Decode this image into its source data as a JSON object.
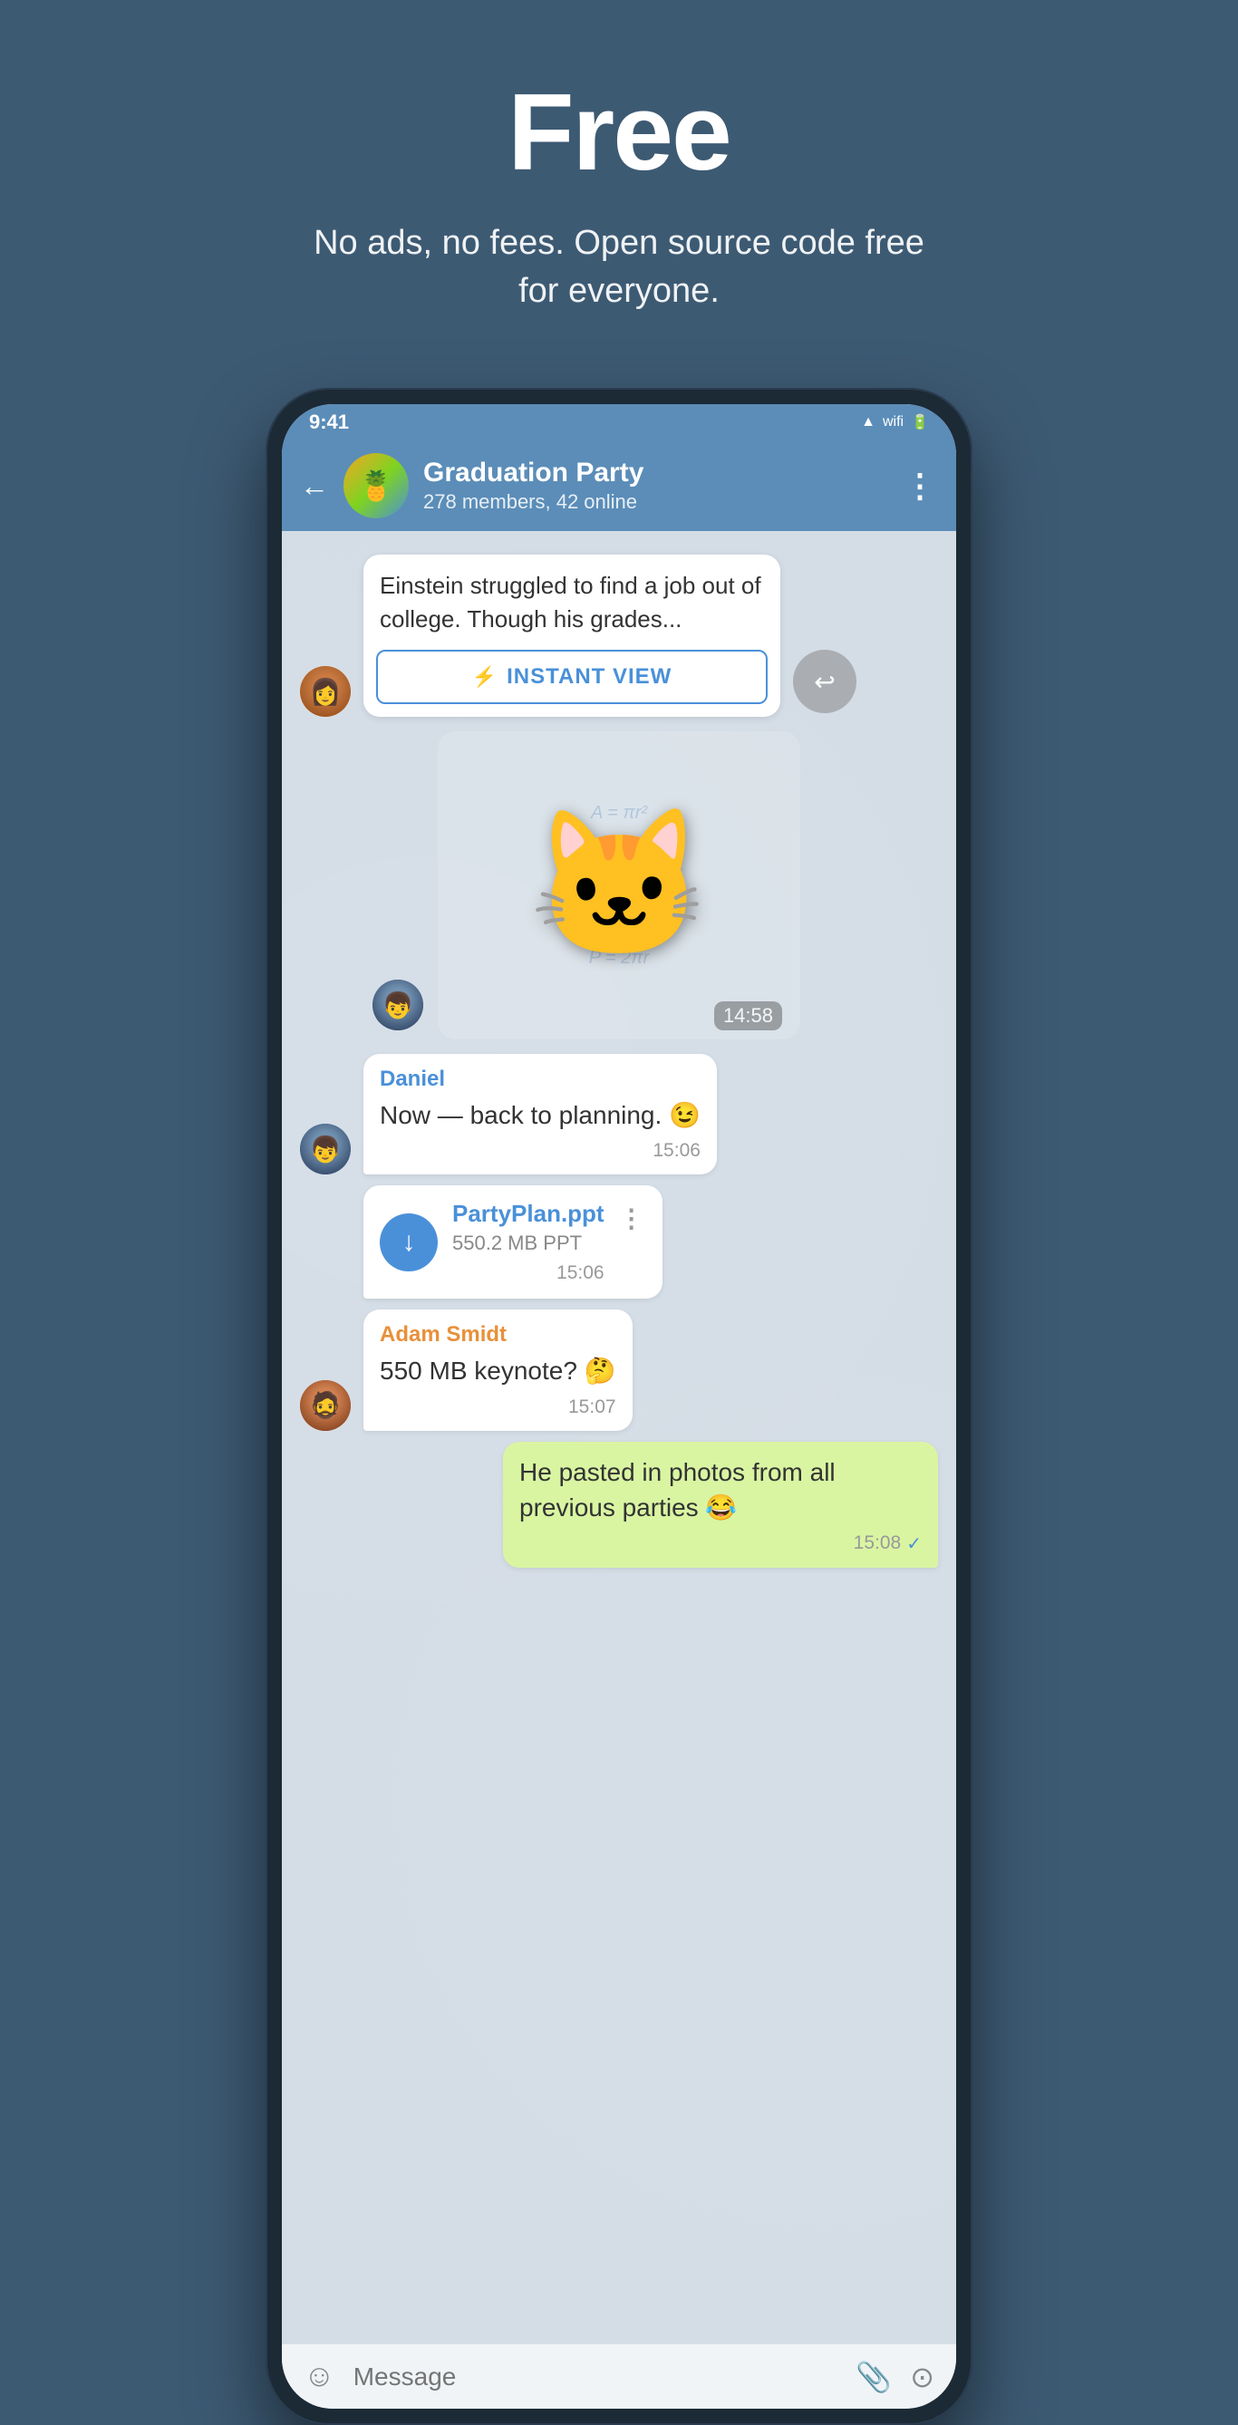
{
  "hero": {
    "title": "Free",
    "subtitle": "No ads, no fees. Open source code free for everyone."
  },
  "phone": {
    "statusBar": {
      "time": "9:41",
      "icons": "▲ WiFi 🔋"
    },
    "header": {
      "backLabel": "←",
      "groupName": "Graduation Party",
      "groupMeta": "278 members, 42 online",
      "moreLabel": "⋮"
    },
    "messages": [
      {
        "id": "article-msg",
        "type": "article",
        "text": "Einstein struggled to find a job out of college. Though his grades...",
        "buttonLabel": "INSTANT VIEW",
        "time": ""
      },
      {
        "id": "sticker-msg",
        "type": "sticker",
        "emoji": "🐱",
        "time": "14:58"
      },
      {
        "id": "daniel-msg",
        "type": "text",
        "sender": "Daniel",
        "senderColor": "blue",
        "text": "Now — back to planning. 😉",
        "time": "15:06"
      },
      {
        "id": "file-msg",
        "type": "file",
        "fileName": "PartyPlan.ppt",
        "fileSize": "550.2 MB PPT",
        "time": "15:06"
      },
      {
        "id": "adam-msg",
        "type": "text",
        "sender": "Adam Smidt",
        "senderColor": "orange",
        "text": "550 MB keynote? 🤔",
        "time": "15:07"
      },
      {
        "id": "self-msg",
        "type": "self",
        "text": "He pasted in photos from all previous parties 😂",
        "time": "15:08",
        "check": "✓"
      }
    ],
    "inputBar": {
      "placeholder": "Message",
      "emojiIcon": "☺",
      "attachIcon": "📎",
      "cameraIcon": "⊙"
    }
  }
}
